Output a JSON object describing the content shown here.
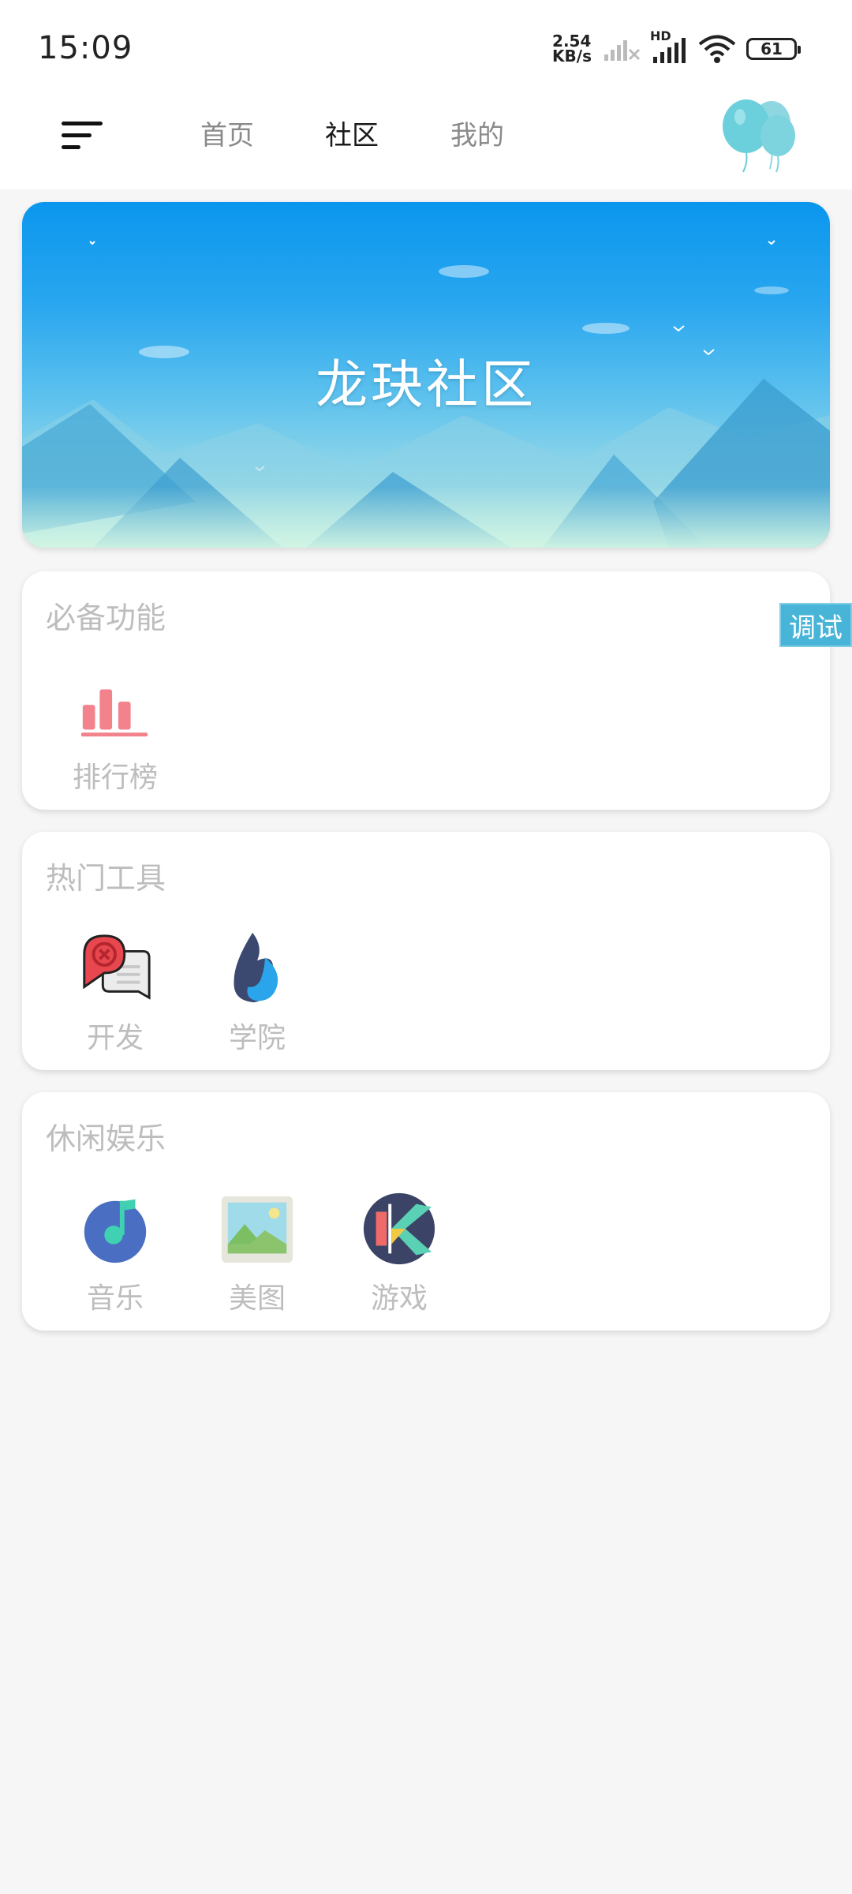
{
  "status_bar": {
    "time": "15:09",
    "net_speed_value": "2.54",
    "net_speed_unit": "KB/s",
    "hd_label": "HD",
    "battery": "61",
    "icons": [
      "signal-off-icon",
      "signal-icon",
      "wifi-icon",
      "battery-icon"
    ]
  },
  "nav": {
    "tabs": [
      {
        "label": "首页",
        "active": false
      },
      {
        "label": "社区",
        "active": true
      },
      {
        "label": "我的",
        "active": false
      }
    ],
    "menu_icon": "menu-icon",
    "avatar_icon": "balloon-icon"
  },
  "banner": {
    "title": "龙玦社区"
  },
  "sections": [
    {
      "title": "必备功能",
      "items": [
        {
          "label": "排行榜",
          "icon": "ranking-icon"
        }
      ]
    },
    {
      "title": "热门工具",
      "items": [
        {
          "label": "开发",
          "icon": "develop-icon"
        },
        {
          "label": "学院",
          "icon": "flame-icon"
        }
      ]
    },
    {
      "title": "休闲娱乐",
      "items": [
        {
          "label": "音乐",
          "icon": "music-icon"
        },
        {
          "label": "美图",
          "icon": "picture-icon"
        },
        {
          "label": "游戏",
          "icon": "game-icon"
        }
      ]
    }
  ],
  "debug_button": {
    "label": "调试"
  },
  "colors": {
    "accent": "#0a96ee",
    "debug": "#48b5d8",
    "ranking": "#f2838c"
  }
}
